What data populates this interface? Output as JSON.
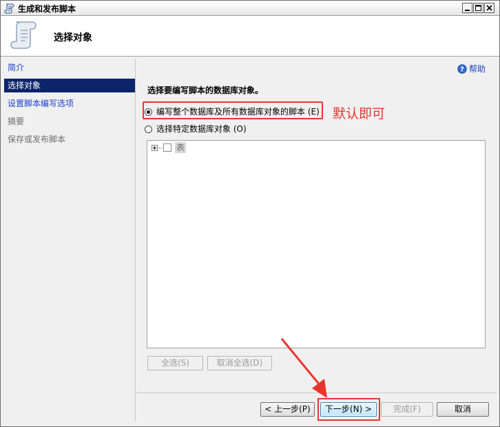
{
  "window": {
    "title": "生成和发布脚本"
  },
  "header": {
    "title": "选择对象"
  },
  "nav": {
    "items": [
      {
        "label": "简介",
        "state": "link"
      },
      {
        "label": "选择对象",
        "state": "selected"
      },
      {
        "label": "设置脚本编写选项",
        "state": "link"
      },
      {
        "label": "摘要",
        "state": "disabled"
      },
      {
        "label": "保存或发布脚本",
        "state": "disabled"
      }
    ]
  },
  "content": {
    "help_label": "帮助",
    "heading": "选择要编写脚本的数据库对象。",
    "options": [
      {
        "label": "编写整个数据库及所有数据库对象的脚本 (E)",
        "checked": true
      },
      {
        "label": "选择特定数据库对象 (O)",
        "checked": false
      }
    ],
    "tree": {
      "item_label": "表"
    },
    "select_all_label": "全选(S)",
    "deselect_all_label": "取消全选(D)"
  },
  "annotation": {
    "text": "默认即可",
    "color": "#e8352c"
  },
  "footer": {
    "prev_label": "< 上一步(P)",
    "next_label": "下一步(N) >",
    "finish_label": "完成(F)",
    "cancel_label": "取消"
  },
  "colors": {
    "selection": "#0c246a",
    "link": "#1a3fcc",
    "highlight": "#e8352c"
  },
  "icons": {
    "app": "script-scroll-icon",
    "help": "help-icon",
    "arrow": "red-arrow-annotation"
  }
}
